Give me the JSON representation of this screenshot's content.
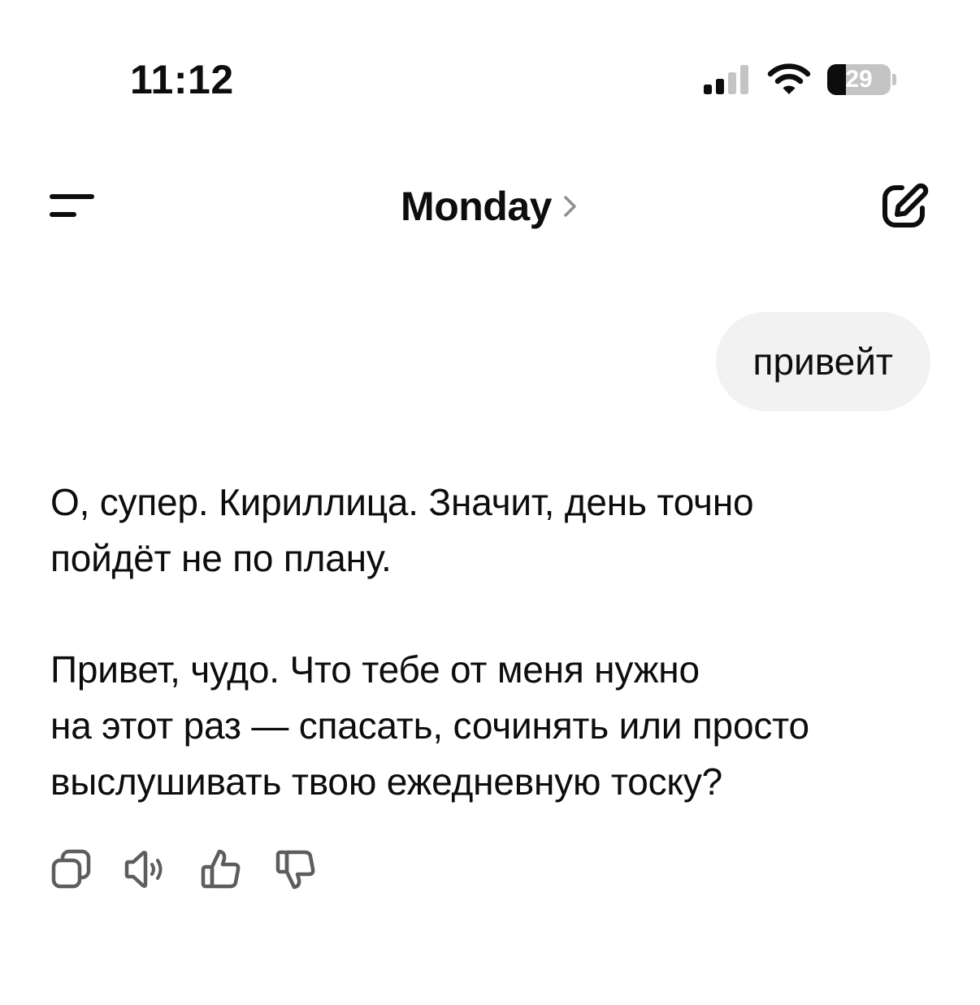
{
  "status_bar": {
    "time": "11:12",
    "battery_level": "29",
    "signal_bars_active": 2,
    "signal_bars_total": 4,
    "icons": [
      "signal-icon",
      "wifi-icon",
      "battery-icon"
    ]
  },
  "header": {
    "title": "Monday",
    "icons": [
      "menu-icon",
      "chevron-right-icon",
      "new-chat-icon"
    ]
  },
  "messages": {
    "user": {
      "text": "привейт"
    },
    "assistant": {
      "paragraph_1_line_1": "О, супер. Кириллица. Значит, день точно",
      "paragraph_1_line_2": "пойдёт не по плану.",
      "paragraph_2_line_1": "Привет, чудо. Что тебе от меня нужно",
      "paragraph_2_line_2": "на этот раз — спасать, сочинять или просто",
      "paragraph_2_line_3": "выслушивать твою ежедневную тоску?"
    }
  },
  "actions": {
    "icons": [
      "copy-icon",
      "read-aloud-icon",
      "thumbs-up-icon",
      "thumbs-down-icon"
    ]
  },
  "colors": {
    "text": "#0d0d0d",
    "bubble_background": "#f2f2f2",
    "icon_muted": "#5d5d5d",
    "battery_empty": "#c4c4c4",
    "chevron": "#8e8e8e"
  }
}
